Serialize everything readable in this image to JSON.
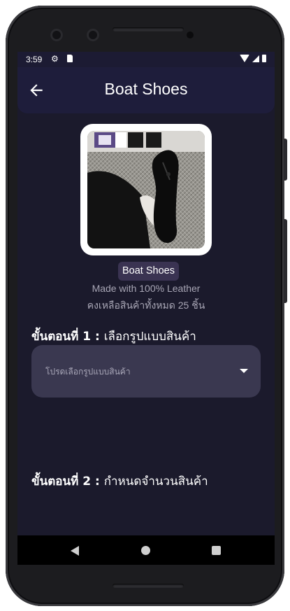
{
  "status_bar": {
    "time": "3:59",
    "icons": [
      "gear-icon",
      "sd-card-icon",
      "wifi-icon",
      "signal-icon",
      "battery-icon"
    ]
  },
  "app_bar": {
    "title": "Boat Shoes",
    "back_icon": "arrow-left-icon"
  },
  "product": {
    "name": "Boat Shoes",
    "description": "Made with 100% Leather",
    "stock": "คงเหลือสินค้าทั้งหมด 25 ชิ้น"
  },
  "step1": {
    "label": "ขั้นตอนที่ 1 :",
    "text": "เลือกรูปแบบสินค้า",
    "dropdown_placeholder": "โปรดเลือกรูปแบบสินค้า"
  },
  "step2": {
    "label": "ขั้นตอนที่ 2 :",
    "text": "กำหนดจำนวนสินค้า"
  },
  "nav_bar": {
    "icons": [
      "nav-back-icon",
      "nav-home-icon",
      "nav-recents-icon"
    ]
  },
  "colors": {
    "background": "#1b1a2c",
    "app_bar": "#1e1d3b",
    "dropdown": "#3a3850",
    "chip": "#3a3352"
  }
}
